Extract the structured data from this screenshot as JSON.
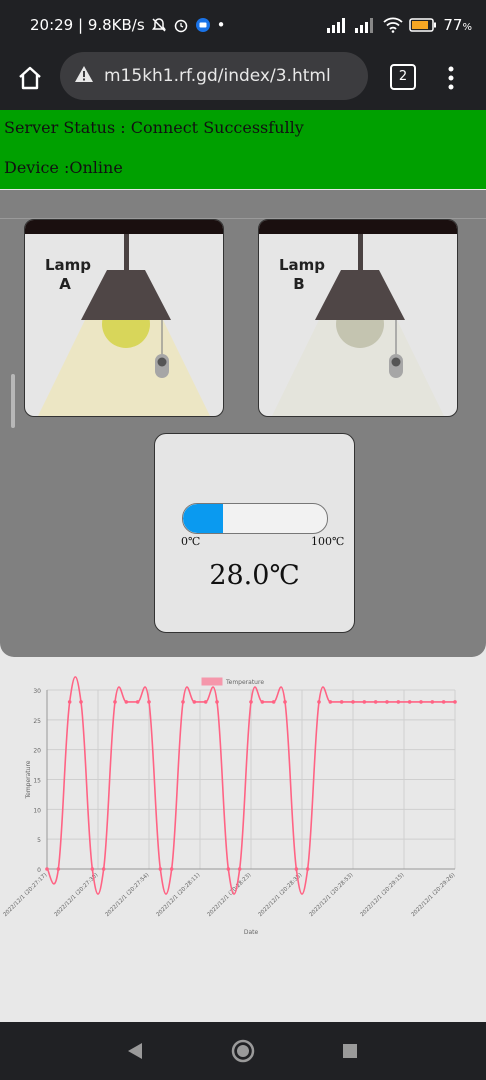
{
  "statusbar": {
    "time_speed": "20:29 | 9.8KB/s",
    "dot": "•",
    "battery": "77",
    "battery_unit": "%"
  },
  "browser": {
    "url": "m15kh1.rf.gd/index/3.html",
    "tab_count": "2"
  },
  "server_status": "Server Status : Connect Successfully",
  "device_status": "Device :Online",
  "lamps": [
    {
      "line1": "Lamp",
      "line2": "A",
      "on": true
    },
    {
      "line1": "Lamp",
      "line2": "B",
      "on": false
    }
  ],
  "thermo": {
    "min_label": "0℃",
    "max_label": "100℃",
    "value_text": "28.0℃",
    "fill_percent": 28
  },
  "colors": {
    "status_green": "#00a000",
    "line": "#ff6384",
    "fill_blue": "#0a9af0"
  },
  "chart_data": {
    "type": "line",
    "title": "",
    "xlabel": "Date",
    "ylabel": "Temperature",
    "ylim": [
      0,
      30
    ],
    "yticks": [
      0,
      5,
      10,
      15,
      20,
      25,
      30
    ],
    "tick_labels": [
      "2022/12/1 (20:27:17)",
      "2022/12/1 (20:27:30)",
      "2022/12/1 (20:27:54)",
      "2022/12/1 (20:28:11)",
      "2022/12/1 (20:28:23)",
      "2022/12/1 (20:28:35)",
      "2022/12/1 (20:28:53)",
      "2022/12/1 (20:29:15)",
      "2022/12/1 (20:29:26)"
    ],
    "series": [
      {
        "name": "Temperature",
        "values": [
          0,
          0,
          28,
          28,
          0,
          0,
          28,
          28,
          28,
          28,
          0,
          0,
          28,
          28,
          28,
          28,
          0,
          0,
          28,
          28,
          28,
          28,
          0,
          0,
          28,
          28,
          28,
          28,
          28,
          28,
          28,
          28,
          28,
          28,
          28,
          28,
          28
        ]
      }
    ]
  }
}
